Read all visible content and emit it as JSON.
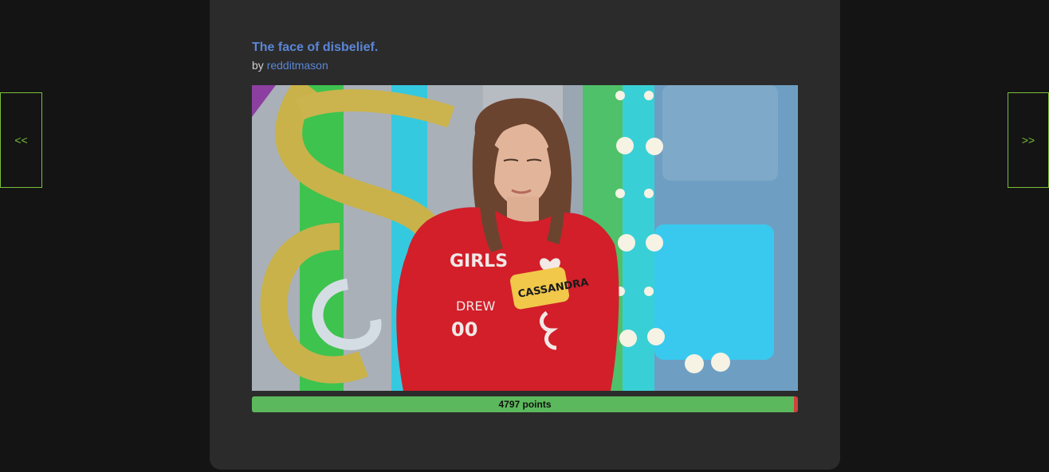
{
  "nav": {
    "prev_label": "<<",
    "next_label": ">>"
  },
  "post": {
    "title": "The face of disbelief.",
    "by_prefix": "by",
    "author": "redditmason",
    "image": {
      "shirt_text_main": "GIRLS",
      "shirt_text_name": "DREW",
      "shirt_text_num": "00",
      "name_tag": "CASSANDRA"
    },
    "points_label": "4797 points",
    "points_fraction": 0.993,
    "colors": {
      "accent_link": "#5b86d6",
      "bar_positive": "#5cb85c",
      "bar_negative": "#d0413a",
      "nav_border": "#7bbf3a"
    }
  }
}
